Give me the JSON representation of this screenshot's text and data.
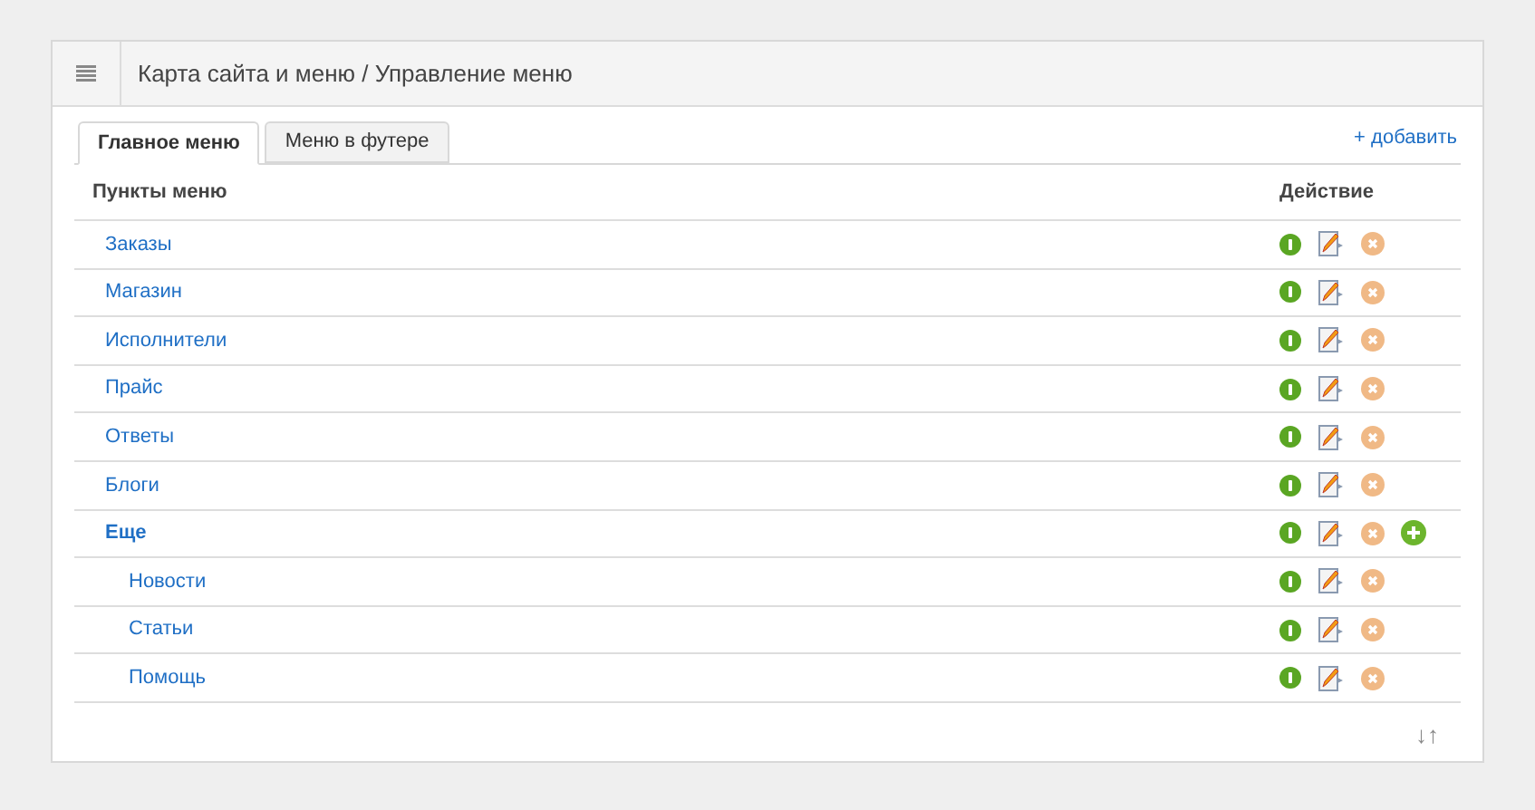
{
  "header": {
    "title": "Карта сайта и меню / Управление меню"
  },
  "tabs": [
    {
      "label": "Главное меню",
      "selected": true
    },
    {
      "label": "Меню в футере",
      "selected": false
    }
  ],
  "add_link": "+ добавить",
  "table": {
    "columns": [
      "Пункты меню",
      "Действие"
    ],
    "rows": [
      {
        "label": "Заказы"
      },
      {
        "label": "Магазин"
      },
      {
        "label": "Исполнители"
      },
      {
        "label": "Прайс"
      },
      {
        "label": "Ответы"
      },
      {
        "label": "Блоги"
      },
      {
        "label": "Еще",
        "children": [
          {
            "label": "Новости"
          },
          {
            "label": "Статьи"
          },
          {
            "label": "Помощь"
          }
        ]
      }
    ]
  },
  "sort_toggle": "↓↑"
}
